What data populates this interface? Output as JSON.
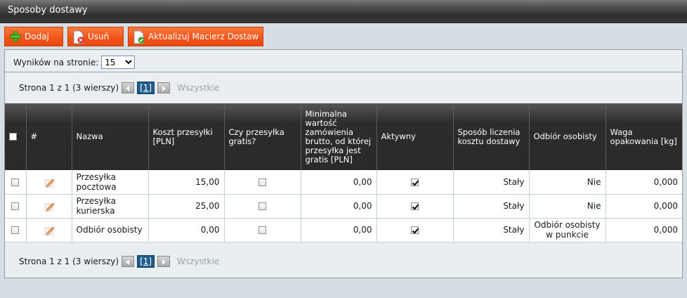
{
  "window": {
    "title": "Sposoby dostawy"
  },
  "toolbar": {
    "add_label": "Dodaj",
    "delete_label": "Usuń",
    "update_label": "Aktualizuj Macierz Dostaw"
  },
  "perpage": {
    "label": "Wyników na stronie:",
    "value": "15"
  },
  "pager": {
    "summary": "Strona 1 z 1 (3 wierszy)",
    "current": "[1]",
    "all": "Wszystkie"
  },
  "table": {
    "columns": [
      "",
      "#",
      "Nazwa",
      "Koszt przesyłki [PLN]",
      "Czy przesyłka gratis?",
      "Minimalna wartość zamówienia brutto, od której przesyłka jest gratis [PLN]",
      "Aktywny",
      "Sposób liczenia kosztu dostawy",
      "Odbiór osobisty",
      "Waga opakowania [kg]"
    ],
    "rows": [
      {
        "name": "Przesyłka pocztowa",
        "cost": "15,00",
        "free": false,
        "min": "0,00",
        "active": true,
        "calc": "Stały",
        "pickup": "Nie",
        "weight": "0,000"
      },
      {
        "name": "Przesyłka kurierska",
        "cost": "25,00",
        "free": false,
        "min": "0,00",
        "active": true,
        "calc": "Stały",
        "pickup": "Nie",
        "weight": "0,000"
      },
      {
        "name": "Odbiór osobisty",
        "cost": "0,00",
        "free": false,
        "min": "0,00",
        "active": true,
        "calc": "Stały",
        "pickup": "Odbiór osobisty w punkcie",
        "weight": "0,000"
      }
    ]
  },
  "colors": {
    "accent": "#f2561c",
    "header": "#2c2c2c",
    "page_active": "#1f5c8a"
  },
  "icons": {
    "add": "plus-icon",
    "delete": "delete-doc-icon",
    "update": "refresh-doc-icon",
    "edit": "pencil-icon"
  }
}
